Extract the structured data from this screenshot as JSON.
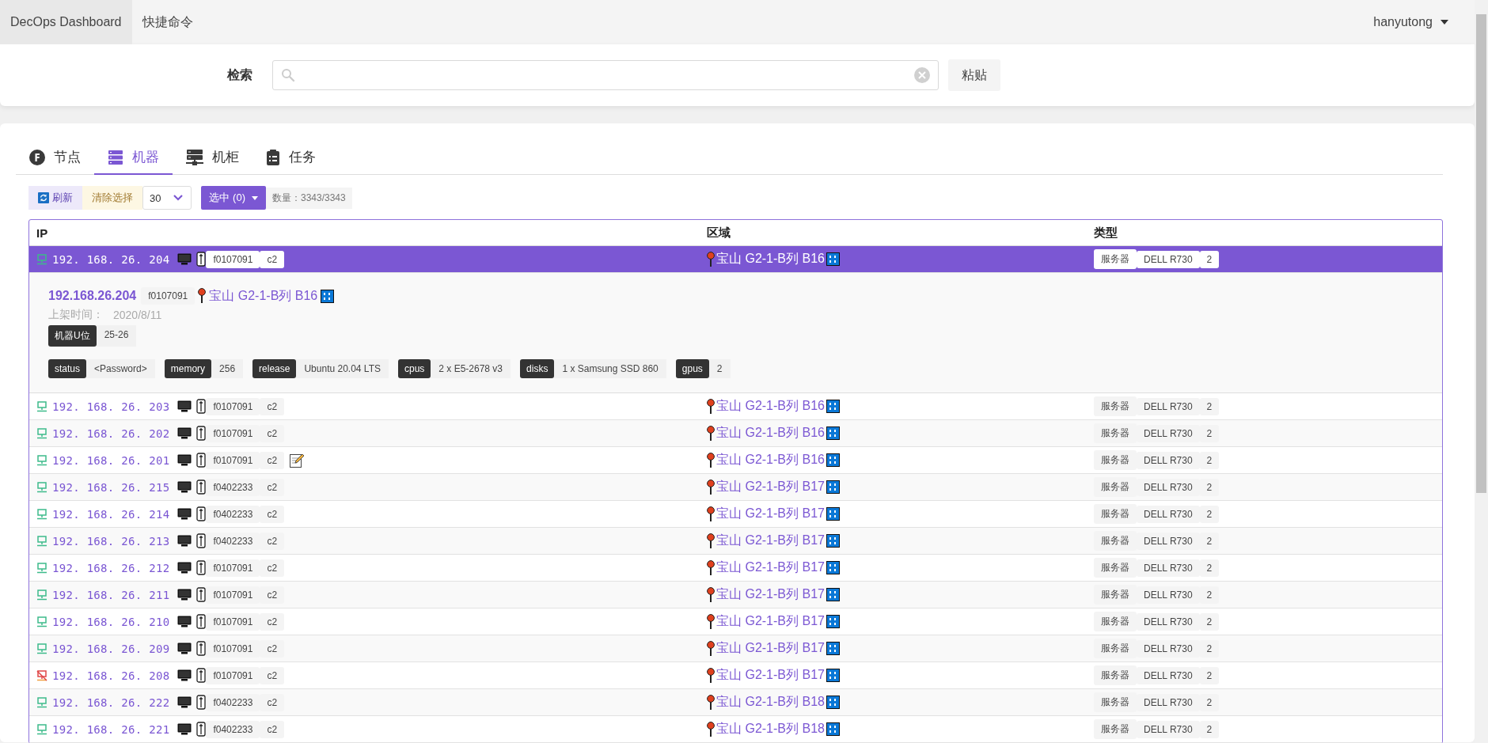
{
  "nav": {
    "brand": "DecOps Dashboard",
    "links": [
      "快捷命令"
    ],
    "user": "hanyutong"
  },
  "search": {
    "label": "检索",
    "paste_button": "粘贴"
  },
  "tabs": [
    {
      "label": "节点",
      "kind": "node",
      "selected": false
    },
    {
      "label": "机器",
      "kind": "machine",
      "selected": true
    },
    {
      "label": "机柜",
      "kind": "cabinet",
      "selected": false
    },
    {
      "label": "任务",
      "kind": "task",
      "selected": false
    }
  ],
  "toolbar": {
    "refresh": "刷新",
    "clear": "清除选择",
    "page_size": "30",
    "select": "选中 (0)",
    "count": "数量：3343/3343"
  },
  "table": {
    "columns": [
      "IP",
      "区域",
      "类型"
    ],
    "rows": [
      {
        "ip": "192. 168. 26. 204",
        "online": true,
        "cabinet": "f0107091",
        "cluster": "c2",
        "note": false,
        "region": "宝山 G2-1-B列 B16",
        "type": "服务器",
        "model": "DELL R730",
        "gpus": "2",
        "selected": true,
        "detail": {
          "ip": "192.168.26.204",
          "cabinet": "f0107091",
          "region": "宝山 G2-1-B列 B16",
          "date_label": "上架时间：",
          "date": "2020/8/11",
          "u_label": "机器U位",
          "u": "25-26",
          "attrs": [
            {
              "key": "status",
              "value": "<Password>"
            },
            {
              "key": "memory",
              "value": "256"
            },
            {
              "key": "release",
              "value": "Ubuntu 20.04 LTS"
            },
            {
              "key": "cpus",
              "value": "2 x E5-2678 v3"
            },
            {
              "key": "disks",
              "value": "1 x Samsung SSD 860"
            },
            {
              "key": "gpus",
              "value": "2"
            }
          ]
        }
      },
      {
        "ip": "192. 168. 26. 203",
        "online": true,
        "cabinet": "f0107091",
        "cluster": "c2",
        "note": false,
        "region": "宝山 G2-1-B列 B16",
        "type": "服务器",
        "model": "DELL R730",
        "gpus": "2",
        "selected": false
      },
      {
        "ip": "192. 168. 26. 202",
        "online": true,
        "cabinet": "f0107091",
        "cluster": "c2",
        "note": false,
        "region": "宝山 G2-1-B列 B16",
        "type": "服务器",
        "model": "DELL R730",
        "gpus": "2",
        "selected": false
      },
      {
        "ip": "192. 168. 26. 201",
        "online": true,
        "cabinet": "f0107091",
        "cluster": "c2",
        "note": true,
        "region": "宝山 G2-1-B列 B16",
        "type": "服务器",
        "model": "DELL R730",
        "gpus": "2",
        "selected": false
      },
      {
        "ip": "192. 168. 26. 215",
        "online": true,
        "cabinet": "f0402233",
        "cluster": "c2",
        "note": false,
        "region": "宝山 G2-1-B列 B17",
        "type": "服务器",
        "model": "DELL R730",
        "gpus": "2",
        "selected": false
      },
      {
        "ip": "192. 168. 26. 214",
        "online": true,
        "cabinet": "f0402233",
        "cluster": "c2",
        "note": false,
        "region": "宝山 G2-1-B列 B17",
        "type": "服务器",
        "model": "DELL R730",
        "gpus": "2",
        "selected": false
      },
      {
        "ip": "192. 168. 26. 213",
        "online": true,
        "cabinet": "f0402233",
        "cluster": "c2",
        "note": false,
        "region": "宝山 G2-1-B列 B17",
        "type": "服务器",
        "model": "DELL R730",
        "gpus": "2",
        "selected": false
      },
      {
        "ip": "192. 168. 26. 212",
        "online": true,
        "cabinet": "f0107091",
        "cluster": "c2",
        "note": false,
        "region": "宝山 G2-1-B列 B17",
        "type": "服务器",
        "model": "DELL R730",
        "gpus": "2",
        "selected": false
      },
      {
        "ip": "192. 168. 26. 211",
        "online": true,
        "cabinet": "f0107091",
        "cluster": "c2",
        "note": false,
        "region": "宝山 G2-1-B列 B17",
        "type": "服务器",
        "model": "DELL R730",
        "gpus": "2",
        "selected": false
      },
      {
        "ip": "192. 168. 26. 210",
        "online": true,
        "cabinet": "f0107091",
        "cluster": "c2",
        "note": false,
        "region": "宝山 G2-1-B列 B17",
        "type": "服务器",
        "model": "DELL R730",
        "gpus": "2",
        "selected": false
      },
      {
        "ip": "192. 168. 26. 209",
        "online": true,
        "cabinet": "f0107091",
        "cluster": "c2",
        "note": false,
        "region": "宝山 G2-1-B列 B17",
        "type": "服务器",
        "model": "DELL R730",
        "gpus": "2",
        "selected": false
      },
      {
        "ip": "192. 168. 26. 208",
        "online": false,
        "cabinet": "f0107091",
        "cluster": "c2",
        "note": false,
        "region": "宝山 G2-1-B列 B17",
        "type": "服务器",
        "model": "DELL R730",
        "gpus": "2",
        "selected": false
      },
      {
        "ip": "192. 168. 26. 222",
        "online": true,
        "cabinet": "f0402233",
        "cluster": "c2",
        "note": false,
        "region": "宝山 G2-1-B列 B18",
        "type": "服务器",
        "model": "DELL R730",
        "gpus": "2",
        "selected": false
      },
      {
        "ip": "192. 168. 26. 221",
        "online": true,
        "cabinet": "f0402233",
        "cluster": "c2",
        "note": false,
        "region": "宝山 G2-1-B列 B18",
        "type": "服务器",
        "model": "DELL R730",
        "gpus": "2",
        "selected": false
      }
    ]
  }
}
